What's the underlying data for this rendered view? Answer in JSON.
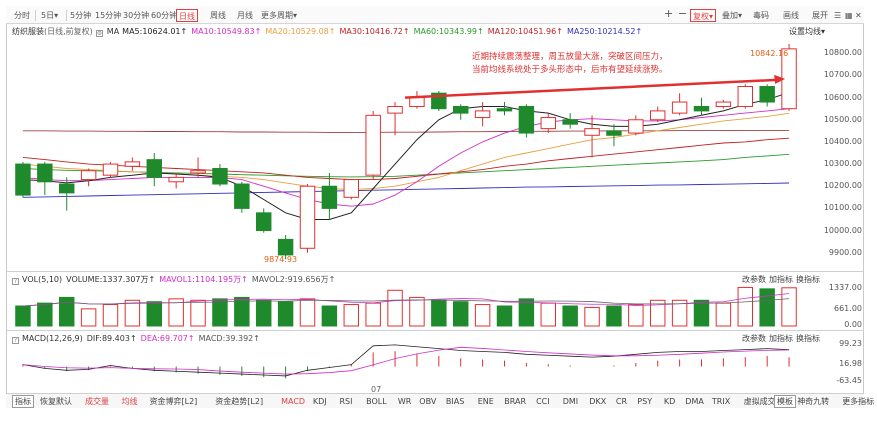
{
  "toolbar": {
    "periods": [
      "分时",
      "5日",
      "5分钟",
      "15分钟",
      "30分钟",
      "60分钟",
      "日线",
      "周线",
      "月线",
      "更多周期"
    ],
    "active_period": "日线",
    "right_buttons": [
      "复权",
      "叠加",
      "毒码",
      "画线",
      "展开"
    ],
    "plus": "+",
    "minus": "−"
  },
  "main_legend": {
    "name": "纺织服装",
    "mode": "(日线,前复权)",
    "ma": "MA",
    "ma5": "MA5:10624.01↑",
    "ma10": "MA10:10549.83↑",
    "ma20": "MA20:10529.08↑",
    "ma30": "MA30:10416.72↑",
    "ma60": "MA60:10343.99↑",
    "ma120": "MA120:10451.96↑",
    "ma250": "MA250:10214.52↑",
    "settings": "设置均线"
  },
  "annotation": {
    "line1": "近期持续震荡整理，周五放量大涨，突破区间压力，",
    "line2": "当前均线系统处于多头形态中，后市有望延续涨势。"
  },
  "price_labels": {
    "high": "10842.16",
    "low": "9874.93"
  },
  "price_axis": [
    "10800.00",
    "10700.00",
    "10600.00",
    "10500.00",
    "10400.00",
    "10300.00",
    "10200.00",
    "10100.00",
    "10000.00",
    "9900.00"
  ],
  "vol_legend": {
    "name": "VOL(5,10)",
    "volume": "VOLUME:1337.307万↑",
    "mavol1": "MAVOL1:1104.195万↑",
    "mavol2": "MAVOL2:919.656万↑",
    "buttons": [
      "改参数",
      "加指标",
      "换指标"
    ]
  },
  "vol_axis": [
    "1337.00",
    "661.00",
    "0.00"
  ],
  "macd_legend": {
    "name": "MACD(12,26,9)",
    "dif": "DIF:89.403↑",
    "dea": "DEA:69.707↑",
    "macd": "MACD:39.392↑",
    "buttons": [
      "改参数",
      "加指标",
      "换指标"
    ]
  },
  "macd_axis": [
    "99.23",
    "16.98",
    "-63.45"
  ],
  "date_label": "07",
  "bottom_tabs": [
    "指标",
    "恢复默认",
    "成交量",
    "均线",
    "资金博弈[L2]",
    "资金趋势[L2]",
    "MACD",
    "KDJ",
    "RSI",
    "BOLL",
    "WR",
    "OBV",
    "BIAS",
    "ENE",
    "BRAR",
    "CCI",
    "DMI",
    "DKX",
    "CR",
    "PSY",
    "KD",
    "DMA",
    "TRIX",
    "虚拟成交量",
    "神奇九转",
    "更多指标",
    "模板"
  ],
  "colors": {
    "up": "#e03030",
    "down": "#1f8a2c",
    "ma5": "#222222",
    "ma10": "#d02fc8",
    "ma20": "#e8a040",
    "ma30": "#c02020",
    "ma60": "#2a9a2a",
    "ma120": "#a04040",
    "ma250": "#3030c0"
  },
  "chart_data": {
    "type": "candlestick",
    "ylim": [
      9840,
      10860
    ],
    "candles": [
      {
        "o": 10300,
        "h": 10310,
        "l": 10150,
        "c": 10160
      },
      {
        "o": 10300,
        "h": 10310,
        "l": 10160,
        "c": 10220
      },
      {
        "o": 10210,
        "h": 10240,
        "l": 10090,
        "c": 10170
      },
      {
        "o": 10230,
        "h": 10280,
        "l": 10200,
        "c": 10270
      },
      {
        "o": 10250,
        "h": 10310,
        "l": 10240,
        "c": 10300
      },
      {
        "o": 10290,
        "h": 10330,
        "l": 10270,
        "c": 10310
      },
      {
        "o": 10320,
        "h": 10350,
        "l": 10200,
        "c": 10240
      },
      {
        "o": 10220,
        "h": 10260,
        "l": 10190,
        "c": 10240
      },
      {
        "o": 10260,
        "h": 10330,
        "l": 10240,
        "c": 10270
      },
      {
        "o": 10280,
        "h": 10300,
        "l": 10200,
        "c": 10210
      },
      {
        "o": 10210,
        "h": 10220,
        "l": 10080,
        "c": 10100
      },
      {
        "o": 10080,
        "h": 10100,
        "l": 9990,
        "c": 10000
      },
      {
        "o": 9960,
        "h": 9980,
        "l": 9870,
        "c": 9890
      },
      {
        "o": 9920,
        "h": 10210,
        "l": 9900,
        "c": 10200
      },
      {
        "o": 10200,
        "h": 10260,
        "l": 10050,
        "c": 10100
      },
      {
        "o": 10150,
        "h": 10230,
        "l": 10140,
        "c": 10230
      },
      {
        "o": 10250,
        "h": 10540,
        "l": 10230,
        "c": 10520
      },
      {
        "o": 10530,
        "h": 10580,
        "l": 10430,
        "c": 10560
      },
      {
        "o": 10560,
        "h": 10630,
        "l": 10550,
        "c": 10600
      },
      {
        "o": 10620,
        "h": 10630,
        "l": 10540,
        "c": 10550
      },
      {
        "o": 10560,
        "h": 10570,
        "l": 10500,
        "c": 10530
      },
      {
        "o": 10510,
        "h": 10580,
        "l": 10470,
        "c": 10540
      },
      {
        "o": 10550,
        "h": 10580,
        "l": 10520,
        "c": 10540
      },
      {
        "o": 10560,
        "h": 10570,
        "l": 10420,
        "c": 10440
      },
      {
        "o": 10460,
        "h": 10530,
        "l": 10440,
        "c": 10510
      },
      {
        "o": 10500,
        "h": 10530,
        "l": 10460,
        "c": 10480
      },
      {
        "o": 10430,
        "h": 10520,
        "l": 10330,
        "c": 10460
      },
      {
        "o": 10450,
        "h": 10480,
        "l": 10380,
        "c": 10430
      },
      {
        "o": 10440,
        "h": 10520,
        "l": 10430,
        "c": 10500
      },
      {
        "o": 10500,
        "h": 10560,
        "l": 10490,
        "c": 10540
      },
      {
        "o": 10530,
        "h": 10620,
        "l": 10520,
        "c": 10580
      },
      {
        "o": 10560,
        "h": 10600,
        "l": 10520,
        "c": 10540
      },
      {
        "o": 10560,
        "h": 10590,
        "l": 10550,
        "c": 10580
      },
      {
        "o": 10560,
        "h": 10660,
        "l": 10550,
        "c": 10650
      },
      {
        "o": 10650,
        "h": 10660,
        "l": 10560,
        "c": 10580
      },
      {
        "o": 10550,
        "h": 10842.16,
        "l": 10540,
        "c": 10820
      }
    ],
    "volume": [
      700,
      800,
      1000,
      600,
      750,
      900,
      850,
      950,
      900,
      950,
      1000,
      900,
      850,
      950,
      700,
      750,
      800,
      1250,
      1000,
      900,
      850,
      750,
      700,
      950,
      800,
      700,
      650,
      700,
      750,
      900,
      900,
      900,
      800,
      1350,
      1300,
      1337.307
    ],
    "macd_bars": [
      10,
      -10,
      -20,
      -15,
      5,
      -10,
      -20,
      -25,
      -30,
      -35,
      -40,
      -45,
      -50,
      -20,
      -5,
      10,
      60,
      65,
      55,
      45,
      35,
      30,
      25,
      15,
      10,
      5,
      0,
      5,
      15,
      25,
      30,
      30,
      35,
      40,
      45,
      39.392
    ],
    "ma5": [
      10230,
      10225,
      10215,
      10225,
      10240,
      10250,
      10260,
      10255,
      10250,
      10240,
      10200,
      10140,
      10080,
      10050,
      10050,
      10080,
      10190,
      10300,
      10410,
      10500,
      10550,
      10560,
      10560,
      10540,
      10530,
      10500,
      10480,
      10470,
      10470,
      10480,
      10500,
      10520,
      10540,
      10570,
      10590,
      10624.01
    ],
    "ma10": [
      10240,
      10230,
      10225,
      10225,
      10230,
      10235,
      10240,
      10240,
      10240,
      10240,
      10230,
      10200,
      10170,
      10140,
      10120,
      10110,
      10120,
      10160,
      10220,
      10290,
      10350,
      10400,
      10440,
      10470,
      10490,
      10500,
      10505,
      10500,
      10495,
      10495,
      10500,
      10510,
      10520,
      10530,
      10540,
      10549.83
    ],
    "ma20": [
      10300,
      10290,
      10280,
      10275,
      10270,
      10265,
      10260,
      10255,
      10250,
      10245,
      10240,
      10230,
      10215,
      10200,
      10190,
      10185,
      10190,
      10200,
      10220,
      10240,
      10270,
      10300,
      10330,
      10350,
      10370,
      10390,
      10410,
      10420,
      10435,
      10450,
      10465,
      10480,
      10495,
      10505,
      10515,
      10529.08
    ],
    "ma30": [
      10330,
      10320,
      10310,
      10300,
      10295,
      10290,
      10285,
      10280,
      10275,
      10270,
      10265,
      10260,
      10250,
      10240,
      10235,
      10230,
      10230,
      10235,
      10245,
      10255,
      10265,
      10275,
      10290,
      10300,
      10315,
      10325,
      10335,
      10345,
      10355,
      10365,
      10375,
      10385,
      10395,
      10400,
      10410,
      10416.72
    ],
    "ma60": [
      10280,
      10275,
      10272,
      10270,
      10268,
      10265,
      10262,
      10260,
      10258,
      10255,
      10252,
      10250,
      10247,
      10245,
      10243,
      10242,
      10243,
      10245,
      10250,
      10255,
      10260,
      10265,
      10270,
      10275,
      10280,
      10285,
      10290,
      10295,
      10300,
      10305,
      10310,
      10315,
      10320,
      10330,
      10337,
      10343.99
    ],
    "ma120": [
      10450,
      10450,
      10449,
      10449,
      10448,
      10448,
      10447,
      10447,
      10446,
      10446,
      10445,
      10445,
      10444,
      10444,
      10443,
      10443,
      10443,
      10444,
      10444,
      10445,
      10446,
      10446,
      10447,
      10448,
      10448,
      10449,
      10449,
      10450,
      10450,
      10450,
      10451,
      10451,
      10451,
      10452,
      10452,
      10451.96
    ],
    "ma250": [
      10150,
      10152,
      10154,
      10156,
      10158,
      10160,
      10162,
      10164,
      10166,
      10168,
      10170,
      10172,
      10174,
      10176,
      10178,
      10180,
      10182,
      10184,
      10186,
      10188,
      10190,
      10192,
      10194,
      10196,
      10197,
      10199,
      10200,
      10202,
      10203,
      10205,
      10206,
      10208,
      10209,
      10211,
      10213,
      10214.52
    ]
  }
}
